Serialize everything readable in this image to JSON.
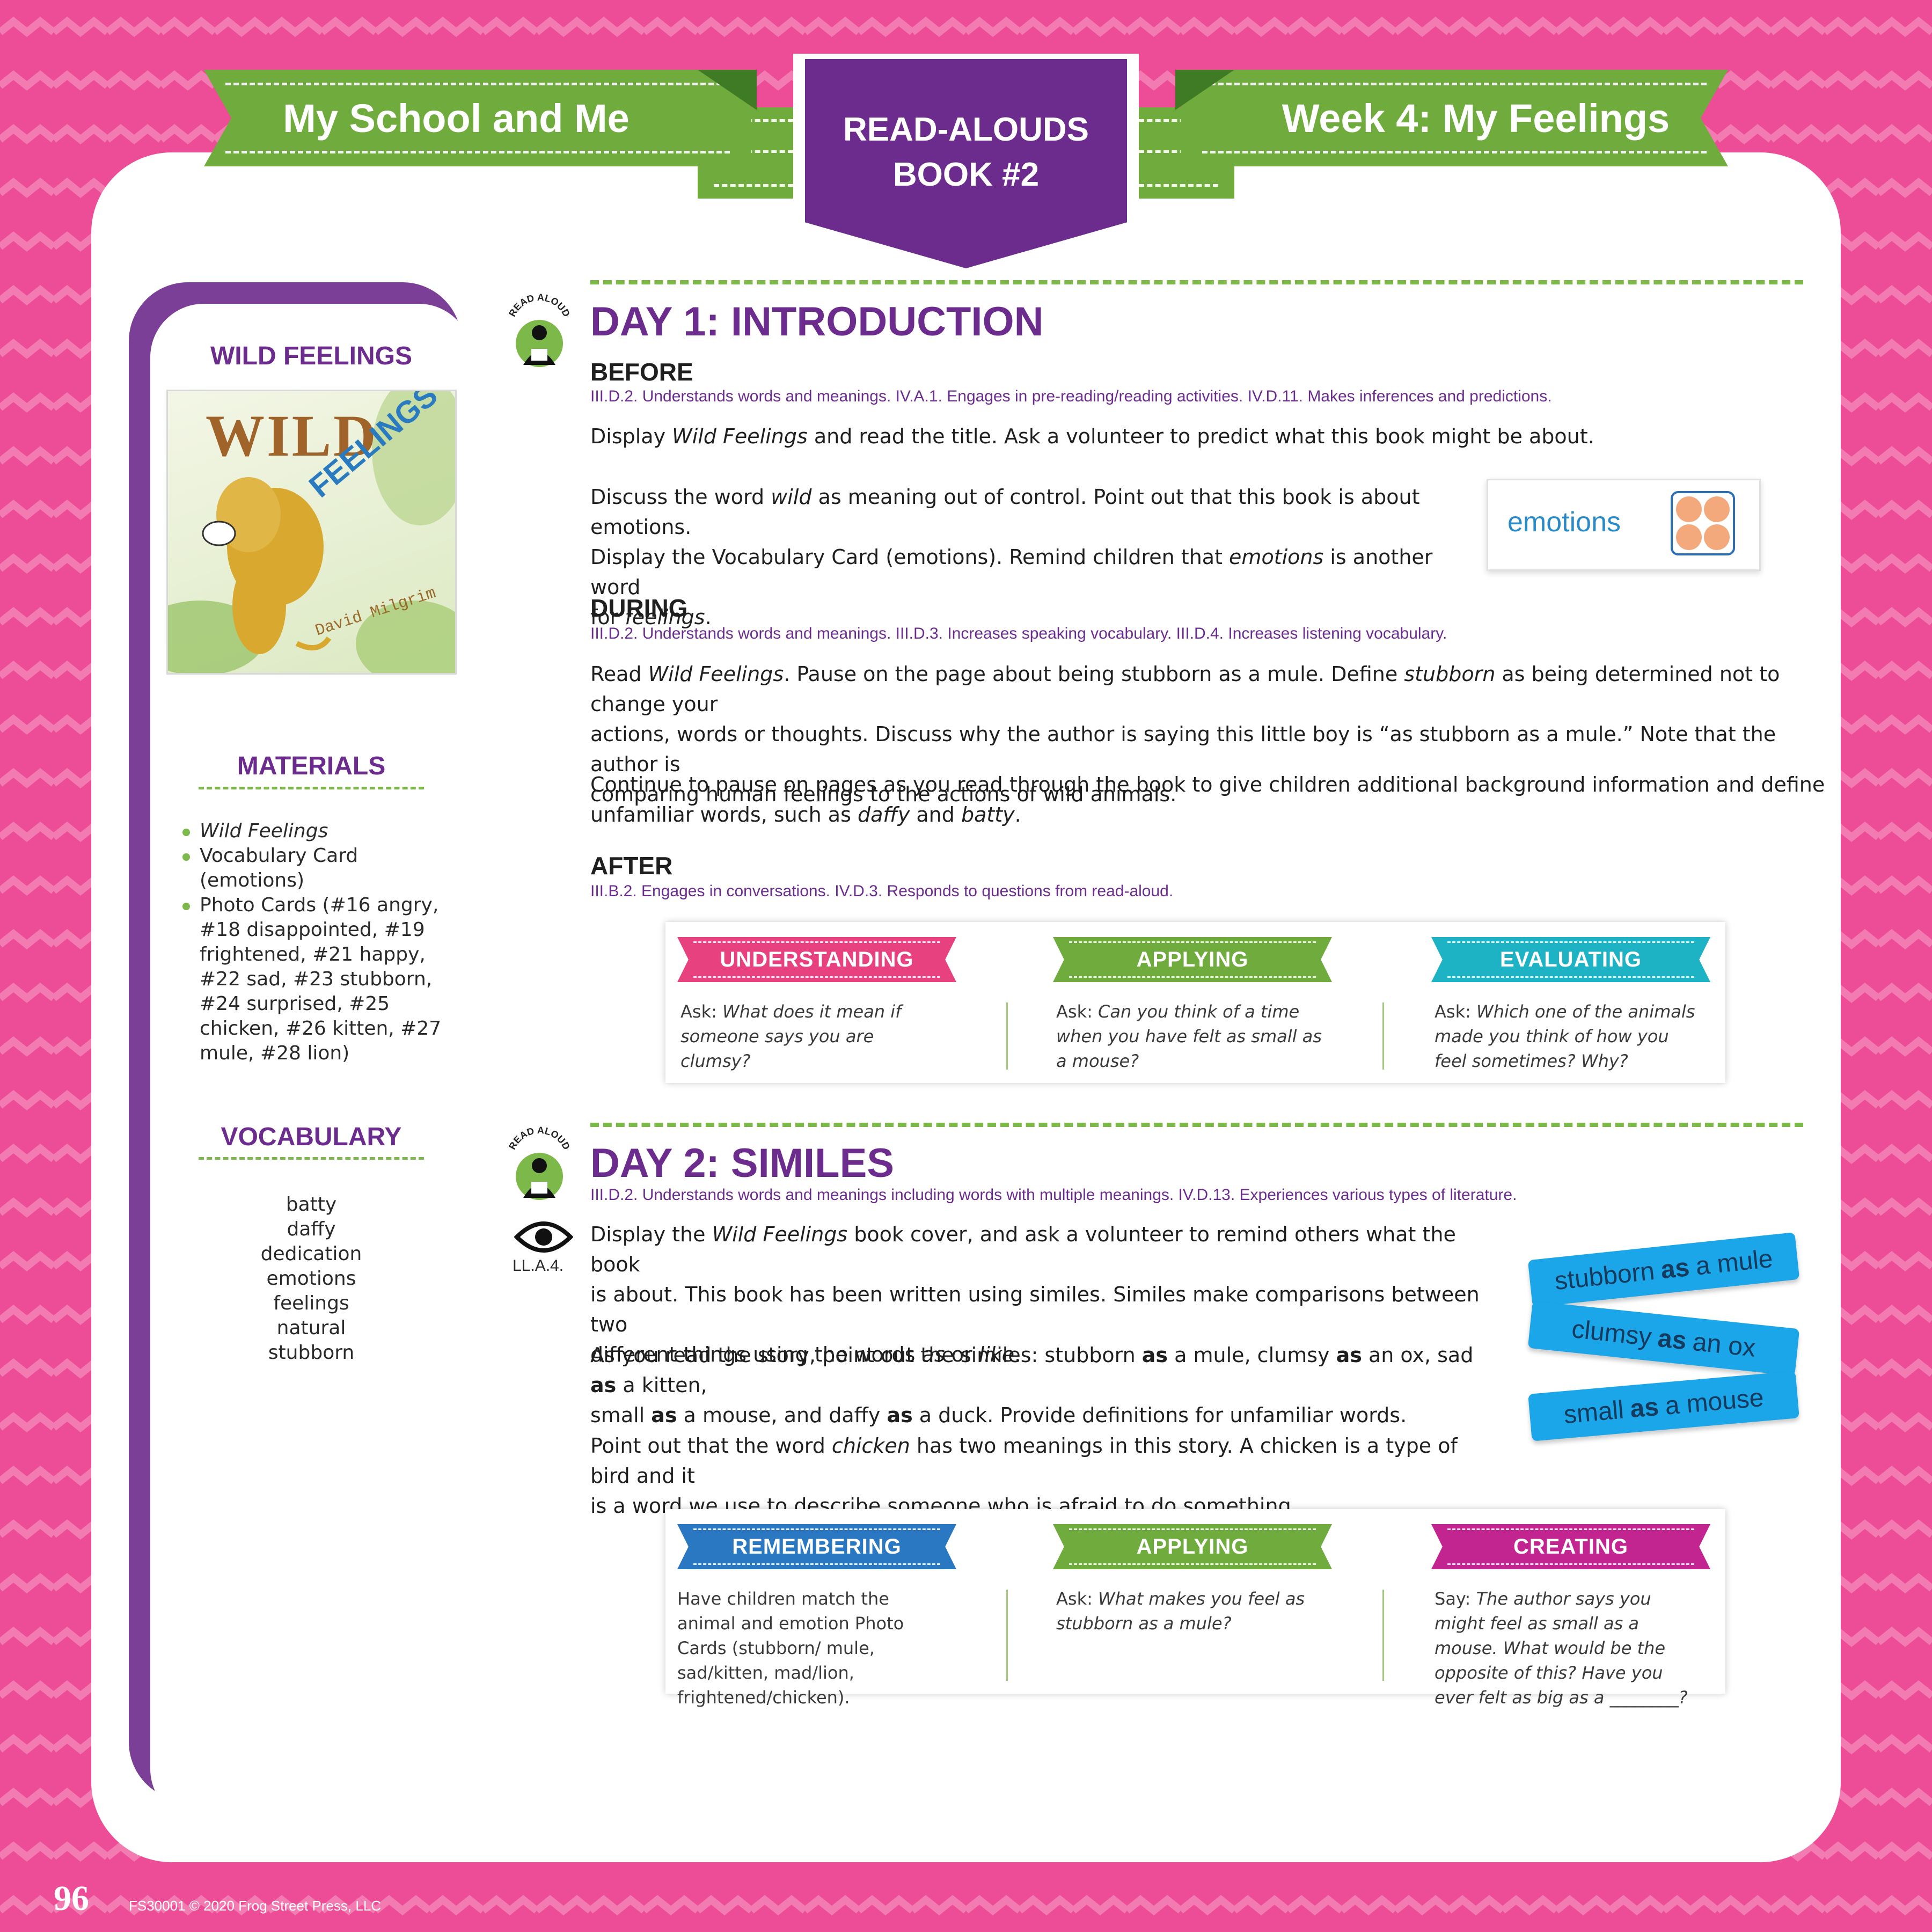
{
  "header": {
    "left_banner": "My School and Me",
    "right_banner": "Week 4: My Feelings",
    "badge_line1": "READ-ALOUDS",
    "badge_line2": "BOOK #2"
  },
  "sidebar": {
    "book_title": "WILD FEELINGS",
    "cover": {
      "title_word1": "WILD",
      "title_word2": "FEELINGS",
      "author": "David Milgrim"
    },
    "materials_title": "MATERIALS",
    "materials": [
      "Wild Feelings",
      "Vocabulary Card (emotions)",
      "Photo Cards (#16 angry, #18 disappointed, #19 frightened, #21 happy, #22 sad, #23 stubborn, #24 surprised, #25 chicken, #26 kitten, #27 mule, #28 lion)"
    ],
    "vocabulary_title": "VOCABULARY",
    "vocabulary": [
      "batty",
      "daffy",
      "dedication",
      "emotions",
      "feelings",
      "natural",
      "stubborn"
    ]
  },
  "read_aloud_icon_label": "READ ALOUD",
  "day1": {
    "title": "DAY 1: INTRODUCTION",
    "before": {
      "heading": "BEFORE",
      "standards": "III.D.2. Understands words and meanings. IV.A.1. Engages in pre-reading/reading activities. IV.D.11. Makes inferences and predictions.",
      "p1_a": "Display ",
      "p1_i": "Wild Feelings",
      "p1_b": " and read the title. Ask a volunteer to predict what this book might be about.",
      "p2_a": "Discuss the word ",
      "p2_i1": "wild",
      "p2_b": " as meaning out of control. Point out that this book is about emotions.",
      "p2_c": "Display the Vocabulary Card (emotions). Remind children that ",
      "p2_i2": "emotions",
      "p2_d": " is another word",
      "p2_e": "for ",
      "p2_i3": "feelings",
      "p2_f": "."
    },
    "vocab_card_word": "emotions",
    "during": {
      "heading": "DURING",
      "standards": "III.D.2. Understands words and meanings. III.D.3. Increases speaking vocabulary. III.D.4. Increases listening vocabulary.",
      "p1_a": "Read ",
      "p1_i1": "Wild Feelings",
      "p1_b": ". Pause on the page about being stubborn as a mule. Define ",
      "p1_i2": "stubborn",
      "p1_c": " as being determined not to change your",
      "p1_line2": "actions, words or thoughts. Discuss why the author is saying this little boy is “as stubborn as a mule.” Note that the author is",
      "p1_line3": "comparing human feelings to the actions of wild animals.",
      "p2_line1": "Continue to pause on pages as you read through the book to give children additional background information and define",
      "p2_a": "unfamiliar words, such as ",
      "p2_i1": "daffy",
      "p2_b": " and ",
      "p2_i2": "batty",
      "p2_c": "."
    },
    "after": {
      "heading": "AFTER",
      "standards": "III.B.2. Engages in conversations. IV.D.3. Responds to questions from read-aloud."
    },
    "questions": [
      {
        "label": "UNDERSTANDING",
        "color": "#e8417f",
        "prefix": "Ask: ",
        "text": "What does it mean if someone says you are clumsy?"
      },
      {
        "label": "APPLYING",
        "color": "#6fab3d",
        "prefix": "Ask: ",
        "text": "Can you think of a time when you have felt as small as a mouse?"
      },
      {
        "label": "EVALUATING",
        "color": "#1db3c4",
        "prefix": "Ask: ",
        "text": "Which one of the animals made you think of how you feel sometimes? Why?"
      }
    ]
  },
  "day2": {
    "title": "DAY 2: SIMILES",
    "standards": "III.D.2. Understands words and meanings including words with multiple meanings. IV.D.13. Experiences various types of literature.",
    "eye_label": "LL.A.4.",
    "p1_a": "Display the ",
    "p1_i": "Wild Feelings",
    "p1_b": " book cover, and ask a volunteer to remind others what the book",
    "p1_line2": "is about. This book has been written using similes. Similes make comparisons between two",
    "p1_c": "different things using the words ",
    "p1_i2": "as",
    "p1_d": " or ",
    "p1_i3": "like",
    "p1_e": ".",
    "p2_line1_a": "As you read the story, point out the similes: stubborn ",
    "as_word": "as",
    "p2_line1_b": " a mule, clumsy ",
    "p2_line1_c": " an ox, sad ",
    "p2_line1_d": " a kitten,",
    "p2_line2_a": "small ",
    "p2_line2_b": " a mouse, and daffy ",
    "p2_line2_c": " a duck. Provide definitions for unfamiliar words.",
    "p3_a": "Point out that the word ",
    "p3_i": "chicken",
    "p3_b": " has two meanings in this story. A chicken is a type of bird and it",
    "p3_line2": "is a word we use to describe someone who is afraid to do something.",
    "strips": [
      {
        "before": "stubborn",
        "as": "as",
        "after": "a mule"
      },
      {
        "before": "clumsy",
        "as": "as",
        "after": "an ox"
      },
      {
        "before": "small",
        "as": "as",
        "after": "a mouse"
      }
    ],
    "questions": [
      {
        "label": "REMEMBERING",
        "color": "#2b78c2",
        "prefix": "",
        "text": "Have children match the animal and emotion Photo Cards (stubborn/ mule, sad/kitten, mad/lion, frightened/chicken)."
      },
      {
        "label": "APPLYING",
        "color": "#6fab3d",
        "prefix": "Ask: ",
        "text": "What makes you feel as stubborn as a mule?"
      },
      {
        "label": "CREATING",
        "color": "#c2258f",
        "prefix": "Say: ",
        "text": "The author says you might feel as small as a mouse. What would be the opposite of this? Have you ever felt as big as a ________?"
      }
    ]
  },
  "footer": {
    "page_number": "96",
    "copyright": "FS30001 © 2020 Frog Street Press, LLC"
  }
}
